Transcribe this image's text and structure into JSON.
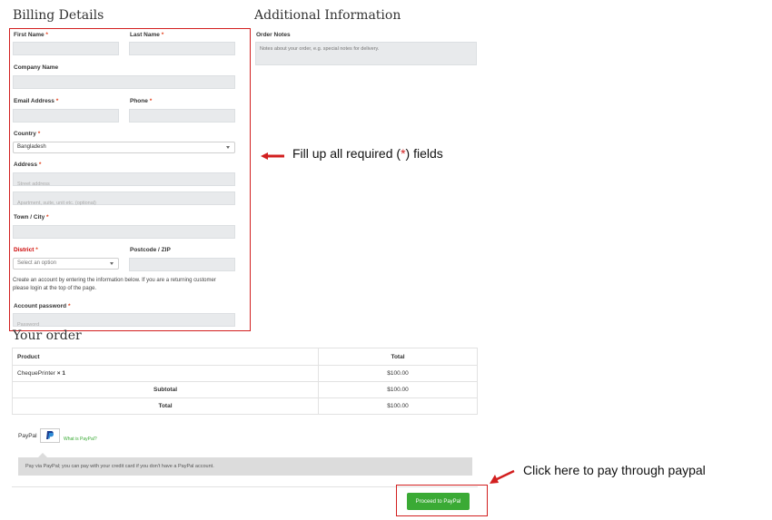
{
  "billing": {
    "heading": "Billing Details",
    "first_name": {
      "label": "First Name",
      "req": "*",
      "value": ""
    },
    "last_name": {
      "label": "Last Name",
      "req": "*",
      "value": ""
    },
    "company_name": {
      "label": "Company Name",
      "value": ""
    },
    "email": {
      "label": "Email Address",
      "req": "*",
      "value": ""
    },
    "phone": {
      "label": "Phone",
      "req": "*",
      "value": ""
    },
    "country": {
      "label": "Country",
      "req": "*",
      "value": "Bangladesh"
    },
    "address": {
      "label": "Address",
      "req": "*",
      "street_placeholder": "Street address",
      "apt_placeholder": "Apartment, suite, unit etc. (optional)"
    },
    "town": {
      "label": "Town / City",
      "req": "*",
      "value": ""
    },
    "district": {
      "label": "District",
      "req": "*",
      "placeholder": "Select an option"
    },
    "postcode": {
      "label": "Postcode / ZIP",
      "value": ""
    },
    "account_note_line1": "Create an account by entering the information below. If you are a returning customer",
    "account_note_line2": "please login at the top of the page.",
    "account_password": {
      "label": "Account password",
      "req": "*",
      "placeholder": "Password"
    }
  },
  "additional": {
    "heading": "Additional Information",
    "order_notes": {
      "label": "Order Notes",
      "placeholder": "Notes about your order, e.g. special notes for delivery."
    }
  },
  "order": {
    "heading": "Your order",
    "columns": [
      "Product",
      "Total"
    ],
    "rows": [
      {
        "product": "ChequePrinter",
        "qty": "× 1",
        "total": "$100.00"
      },
      {
        "label": "Subtotal",
        "total": "$100.00"
      },
      {
        "label": "Total",
        "total": "$100.00"
      }
    ]
  },
  "payment": {
    "method": "PayPal",
    "what_is": "What is PayPal?",
    "description": "Pay via PayPal; you can pay with your credit card if you don't have a PayPal account.",
    "button_label": "Proceed to PayPal"
  },
  "annotations": {
    "fill_required_pre": "Fill up all required (",
    "fill_required_star": "*",
    "fill_required_post": ") fields",
    "pay_paypal": "Click here to pay through paypal"
  },
  "colors": {
    "accent": "#3aaa35",
    "annotation_red": "#d21f1f",
    "required": "#e2401c"
  }
}
